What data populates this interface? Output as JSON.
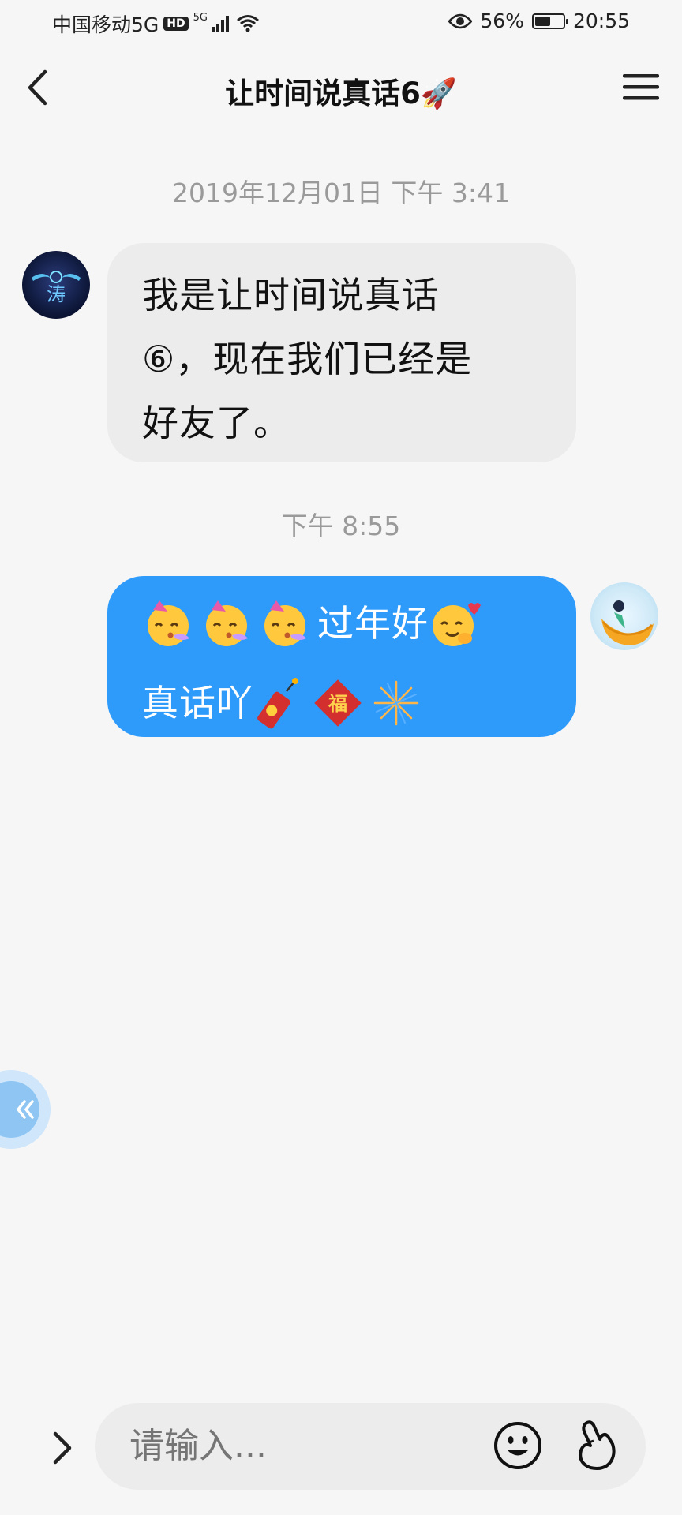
{
  "status_bar": {
    "carrier": "中国移动5G",
    "hd_badge": "HD",
    "signal_5g": "5G",
    "battery_percent": "56%",
    "battery_level": 0.56,
    "time": "20:55"
  },
  "header": {
    "title": "让时间说真话6🚀",
    "back_icon": "chevron-left-icon",
    "menu_icon": "hamburger-menu-icon"
  },
  "messages": [
    {
      "timestamp": "2019年12月01日 下午 3:41",
      "side": "left",
      "lines": [
        "我是让时间说真话",
        "⑥，现在我们已经是",
        "好友了。"
      ]
    },
    {
      "timestamp": "下午 8:55",
      "side": "right",
      "line1_text": "过年好",
      "line2_text": "真话吖",
      "emojis": [
        "party-face",
        "party-face",
        "party-face",
        "smiling-hearts",
        "firecracker",
        "fu-diamond",
        "fireworks"
      ]
    }
  ],
  "input": {
    "placeholder": "请输入...",
    "expand_icon": "chevron-right-icon",
    "emoji_icon": "smiley-icon",
    "gesture_icon": "finger-heart-icon"
  },
  "colors": {
    "sent_bubble": "#2e9bfb",
    "received_bubble": "#ececec",
    "background": "#f6f6f6",
    "timestamp": "#9a9a9a"
  }
}
